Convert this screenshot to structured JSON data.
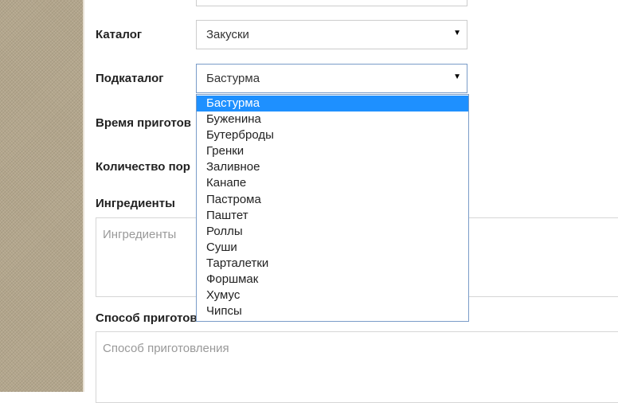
{
  "form": {
    "catalog": {
      "label": "Каталог",
      "value": "Закуски"
    },
    "subcatalog": {
      "label": "Подкаталог",
      "value": "Бастурма",
      "options": [
        "Бастурма",
        "Буженина",
        "Бутерброды",
        "Гренки",
        "Заливное",
        "Канапе",
        "Пастрома",
        "Паштет",
        "Роллы",
        "Суши",
        "Тарталетки",
        "Форшмак",
        "Хумус",
        "Чипсы"
      ]
    },
    "cooking_time": {
      "label": "Время приготов"
    },
    "portions": {
      "label": "Количество пор"
    },
    "ingredients": {
      "label": "Ингредиенты",
      "placeholder": "Ингредиенты"
    },
    "method": {
      "label": "Способ приготовления",
      "placeholder": "Способ приготовления"
    }
  },
  "icons": {
    "select_arrow": "chevron-down-icon"
  },
  "colors": {
    "highlight": "#1e90ff",
    "sidebar": "#b3a68c",
    "active_border": "#7a9cc8"
  }
}
